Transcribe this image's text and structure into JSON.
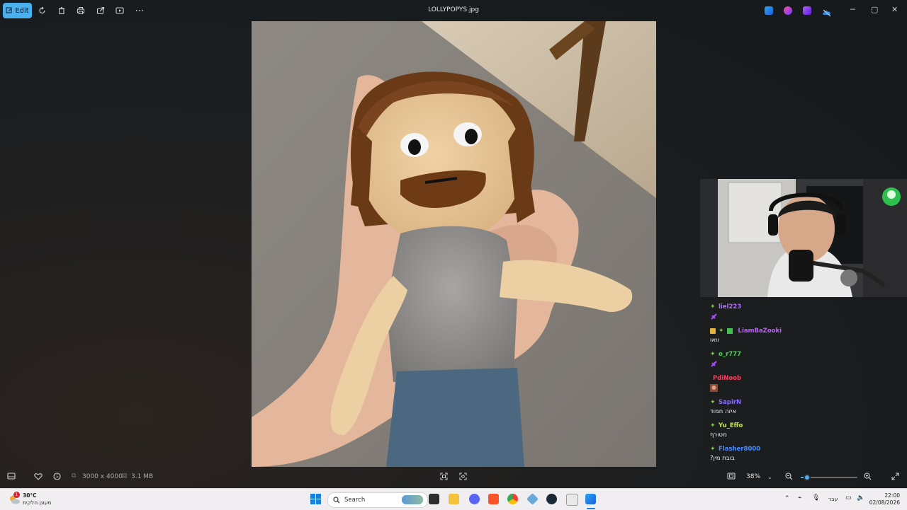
{
  "window": {
    "title": "LOLLYPOPYS.jpg",
    "edit_label": "Edit"
  },
  "bottom": {
    "dimensions": "3000 x 4000",
    "filesize": "3.1 MB",
    "zoom": "38%",
    "zoom_fraction": 0.05
  },
  "chat": {
    "messages": [
      {
        "user": "liel223",
        "color": "#b46bff",
        "text": "",
        "emote": "purple-emote"
      },
      {
        "user": "LiamBaZooki",
        "color": "#c05cff",
        "text": "וואו",
        "emote": ""
      },
      {
        "user": "o_r777",
        "color": "#4fd14f",
        "text": "",
        "emote": "purple-emote"
      },
      {
        "user": "PdiNoob",
        "color": "#ff3b5c",
        "text": "",
        "emote": "face-emote"
      },
      {
        "user": "SapirN",
        "color": "#8a6bff",
        "text": "איזה חמוד",
        "emote": ""
      },
      {
        "user": "Yu_Effo",
        "color": "#c8e63b",
        "text": "מטורף",
        "emote": ""
      },
      {
        "user": "Flasher8000",
        "color": "#4a8cff",
        "text": "בובת מין?",
        "emote": ""
      }
    ]
  },
  "taskbar": {
    "weather_temp": "30°C",
    "weather_desc": "מעונן חלקית",
    "search_placeholder": "Search",
    "lang": "עבר",
    "time": "22:00",
    "date": "02/08/2026",
    "notification_count": "1"
  }
}
